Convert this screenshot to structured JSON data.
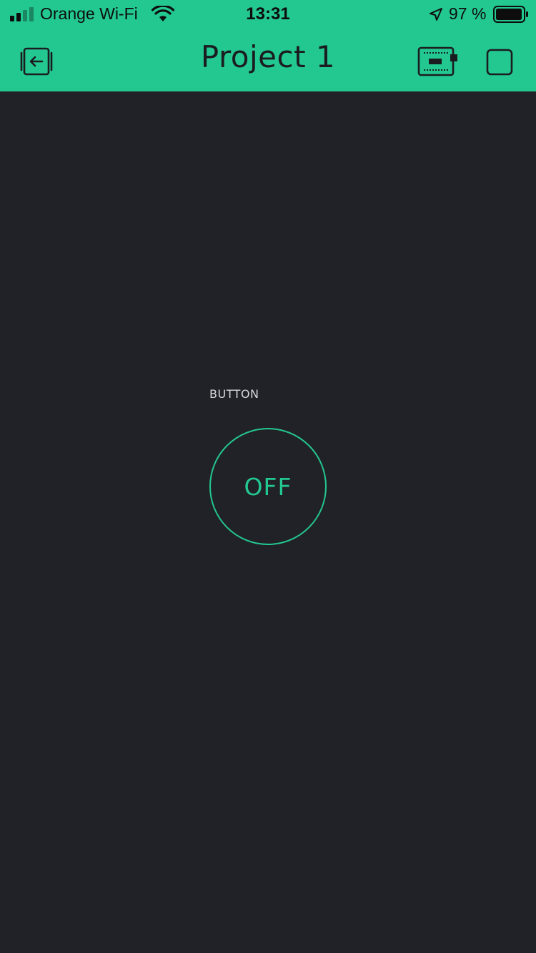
{
  "status_bar": {
    "carrier": "Orange Wi-Fi",
    "time": "13:31",
    "battery_percent": "97 %"
  },
  "nav": {
    "title": "Project 1",
    "back_icon": "exit-project-icon",
    "device_icon": "device-board-icon",
    "stop_icon": "stop-square-icon"
  },
  "widget": {
    "label": "BUTTON",
    "state_text": "OFF",
    "accent_color": "#23c890"
  },
  "colors": {
    "header": "#23c890",
    "background": "#212227"
  }
}
